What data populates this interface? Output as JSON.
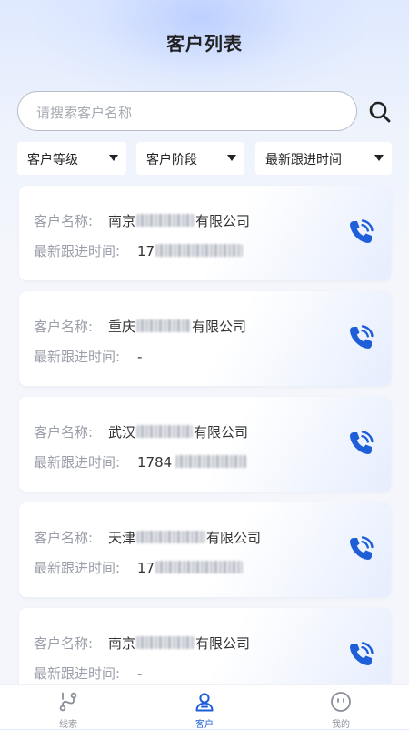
{
  "header": {
    "title": "客户列表"
  },
  "search": {
    "placeholder": "请搜索客户名称"
  },
  "filters": [
    {
      "label": "客户等级"
    },
    {
      "label": "客户阶段"
    },
    {
      "label": "最新跟进时间"
    }
  ],
  "card_labels": {
    "name": "客户名称:",
    "time": "最新跟进时间:"
  },
  "customers": [
    {
      "name_prefix": "南京",
      "name_suffix": "有限公司",
      "time_prefix": "17",
      "time_suffix": ""
    },
    {
      "name_prefix": "重庆",
      "name_suffix": "有限公司",
      "time_prefix": "-",
      "time_suffix": ""
    },
    {
      "name_prefix": "武汉",
      "name_suffix": "有限公司",
      "time_prefix": "1784",
      "time_suffix": ""
    },
    {
      "name_prefix": "天津",
      "name_suffix": "有限公司",
      "time_prefix": "17",
      "time_suffix": ""
    },
    {
      "name_prefix": "南京",
      "name_suffix": "有限公司",
      "time_prefix": "-",
      "time_suffix": ""
    }
  ],
  "tabbar": {
    "items": [
      {
        "label": "线索",
        "icon": "route-icon",
        "active": false
      },
      {
        "label": "客户",
        "icon": "person-icon",
        "active": true
      },
      {
        "label": "我的",
        "icon": "face-icon",
        "active": false
      }
    ]
  },
  "colors": {
    "accent": "#1e5fd8",
    "inactive": "#8a8f99"
  }
}
